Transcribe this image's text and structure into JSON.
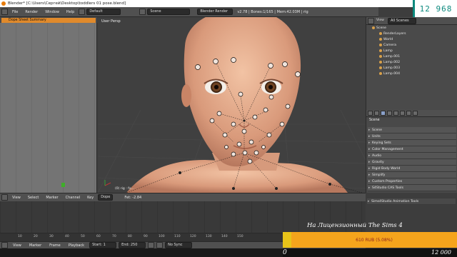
{
  "window": {
    "title": "Blender* [C:\\Users\\Сергей\\Desktop\\toddlers 01 pose.blend]"
  },
  "menubar": {
    "items": [
      "File",
      "Render",
      "Window",
      "Help"
    ],
    "layout": "Default",
    "scene": "Scene",
    "engine": "Blender Render",
    "info": "v2.78 | Bones:1/165 | Mem:42.03M | rig"
  },
  "dopesheet": {
    "summary": "Dope Sheet Summary"
  },
  "viewport": {
    "label": "User Persp",
    "status": "(0) rig : fo..."
  },
  "outliner": {
    "view_label": "View",
    "search_label": "All Scenes",
    "rows": [
      {
        "label": "Scene",
        "indent": 0
      },
      {
        "label": "RenderLayers",
        "indent": 1
      },
      {
        "label": "World",
        "indent": 1
      },
      {
        "label": "Camera",
        "indent": 1
      },
      {
        "label": "Lamp",
        "indent": 1
      },
      {
        "label": "Lamp.001",
        "indent": 1
      },
      {
        "label": "Lamp.002",
        "indent": 1
      },
      {
        "label": "Lamp.003",
        "indent": 1
      },
      {
        "label": "Lamp.004",
        "indent": 1
      }
    ]
  },
  "properties": {
    "context": "Scene",
    "panels": [
      "Scene",
      "Units",
      "Keying Sets",
      "Color Management",
      "Audio",
      "Gravity",
      "Rigid Body World",
      "Simplify",
      "Custom Properties",
      "S4Studio CAS Tools",
      "Sims4Studio Animation Tools"
    ]
  },
  "timeline": {
    "menu": [
      "View",
      "Select",
      "Marker",
      "Channel",
      "Key"
    ],
    "mode": "Dope",
    "value": "Fet: -2.84",
    "ticks": [
      "10",
      "20",
      "30",
      "40",
      "50",
      "60",
      "70",
      "80",
      "90",
      "100",
      "110",
      "120",
      "130",
      "140",
      "150"
    ],
    "bottom_menu": [
      "View",
      "Marker",
      "Frame",
      "Playback"
    ],
    "start": "Start: 1",
    "end": "End: 250",
    "sync": "No Sync"
  },
  "overlay": {
    "counter": "12 968",
    "caption": "На Лицензионный The Sims 4",
    "donation": "610 RUB (5.08%)",
    "left_value": "0",
    "right_value": "12 000"
  },
  "colors": {
    "accent_orange": "#e08a2c",
    "counter_teal": "#0c8a7e",
    "donation_bg": "#f5a41c"
  }
}
